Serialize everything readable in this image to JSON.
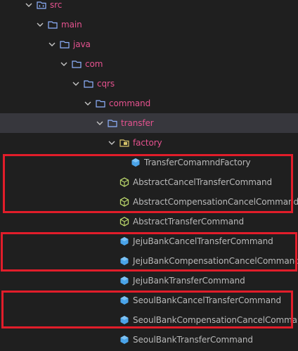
{
  "tree": {
    "folders": [
      {
        "label": "src",
        "icon": "src-folder-icon"
      },
      {
        "label": "main",
        "icon": "folder-icon"
      },
      {
        "label": "java",
        "icon": "folder-icon"
      },
      {
        "label": "com",
        "icon": "folder-icon"
      },
      {
        "label": "cqrs",
        "icon": "folder-icon"
      },
      {
        "label": "command",
        "icon": "folder-icon"
      },
      {
        "label": "transfer",
        "icon": "folder-icon"
      },
      {
        "label": "factory",
        "icon": "package-folder-icon"
      }
    ],
    "files": [
      {
        "label": "TransferComamndFactory",
        "icon": "class-icon-blue"
      },
      {
        "label": "AbstractCancelTransferCommand",
        "icon": "abstract-class-icon-green"
      },
      {
        "label": "AbstractCompensationCancelCommand",
        "icon": "abstract-class-icon-green"
      },
      {
        "label": "AbstractTransferCommand",
        "icon": "abstract-class-icon-green"
      },
      {
        "label": "JejuBankCancelTransferCommand",
        "icon": "class-icon-blue"
      },
      {
        "label": "JejuBankCompensationCancelCommand",
        "icon": "class-icon-blue"
      },
      {
        "label": "JejuBankTransferCommand",
        "icon": "class-icon-blue"
      },
      {
        "label": "SeoulBankCancelTransferCommand",
        "icon": "class-icon-blue"
      },
      {
        "label": "SeoulBankCompensationCancelCommand",
        "icon": "class-icon-blue"
      },
      {
        "label": "SeoulBankTransferCommand",
        "icon": "class-icon-blue"
      }
    ],
    "selected": "transfer"
  },
  "colors": {
    "background": "#1f1f1f",
    "folder_label": "#e5528f",
    "file_label": "#b9b9b9",
    "folder_icon": "#8fb2ff",
    "class_icon": "#4aa3e8",
    "abstract_icon": "#b7d36a",
    "highlight": "#e11d2a",
    "selected_row": "#37373d"
  }
}
